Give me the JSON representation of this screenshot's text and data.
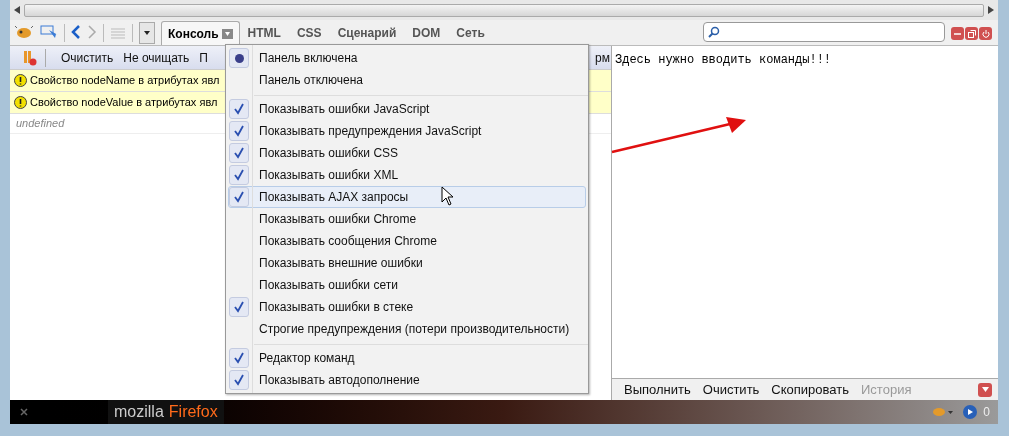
{
  "firebug_toolbar": {
    "tabs": [
      {
        "label": "Консоль",
        "selected": true
      },
      {
        "label": "HTML",
        "selected": false
      },
      {
        "label": "CSS",
        "selected": false
      },
      {
        "label": "Сценарий",
        "selected": false
      },
      {
        "label": "DOM",
        "selected": false
      },
      {
        "label": "Сеть",
        "selected": false
      }
    ]
  },
  "console_toolbar": {
    "buttons": [
      "Очистить",
      "Не очищать",
      "П"
    ],
    "cut_right": "рм"
  },
  "messages": [
    {
      "kind": "warning",
      "text": "Свойство nodeName в атрибутах явл"
    },
    {
      "kind": "warning",
      "text": "Свойство nodeValue в атрибутах явл"
    },
    {
      "kind": "result",
      "text": "undefined"
    }
  ],
  "menu": [
    {
      "kind": "radio",
      "label": "Панель включена",
      "checked": true
    },
    {
      "kind": "radio",
      "label": "Панель отключена",
      "checked": false
    },
    {
      "kind": "separator"
    },
    {
      "kind": "check",
      "label": "Показывать ошибки JavaScript",
      "checked": true
    },
    {
      "kind": "check",
      "label": "Показывать предупреждения JavaScript",
      "checked": true
    },
    {
      "kind": "check",
      "label": "Показывать ошибки CSS",
      "checked": true
    },
    {
      "kind": "check",
      "label": "Показывать ошибки XML",
      "checked": true
    },
    {
      "kind": "check",
      "label": "Показывать AJAX запросы",
      "checked": true,
      "hovered": true
    },
    {
      "kind": "check",
      "label": "Показывать ошибки Chrome",
      "checked": false
    },
    {
      "kind": "check",
      "label": "Показывать сообщения Chrome",
      "checked": false
    },
    {
      "kind": "check",
      "label": "Показывать внешние ошибки",
      "checked": false
    },
    {
      "kind": "check",
      "label": "Показывать ошибки сети",
      "checked": false
    },
    {
      "kind": "check",
      "label": "Показывать ошибки в стеке",
      "checked": true
    },
    {
      "kind": "check",
      "label": "Строгие предупреждения (потери производительности)",
      "checked": false
    },
    {
      "kind": "separator"
    },
    {
      "kind": "check",
      "label": "Редактор команд",
      "checked": true
    },
    {
      "kind": "check",
      "label": "Показывать автодополнение",
      "checked": true
    }
  ],
  "command_editor": {
    "text": "Здесь нужно вводить команды!!!",
    "buttons": [
      {
        "label": "Выполнить",
        "disabled": false
      },
      {
        "label": "Очистить",
        "disabled": false
      },
      {
        "label": "Скопировать",
        "disabled": false
      },
      {
        "label": "История",
        "disabled": true
      }
    ]
  },
  "status_bar": {
    "logo_left": "mozilla",
    "logo_right": "Firefox",
    "count": "0"
  }
}
